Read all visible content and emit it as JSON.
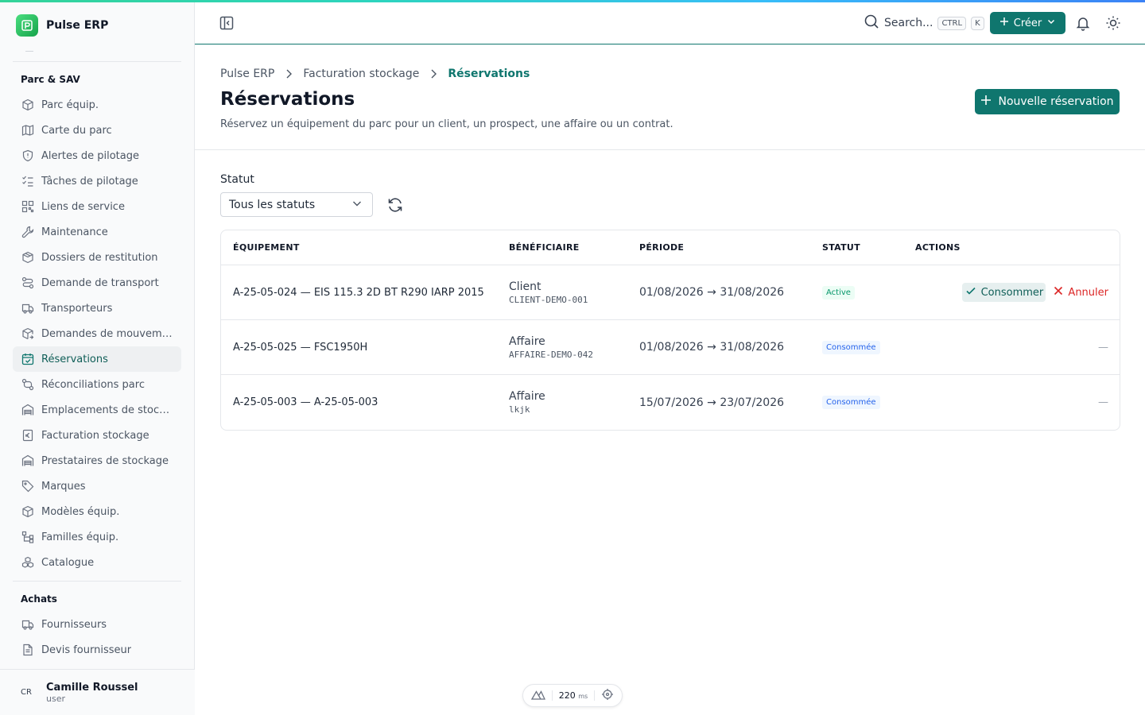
{
  "app": {
    "name": "Pulse ERP"
  },
  "colors": {
    "accent": "#0f766e",
    "active_badge": "#059669",
    "consumed_badge": "#2563eb",
    "danger": "#dc2626"
  },
  "sidebar": {
    "sections": [
      {
        "title": "Parc & SAV",
        "items": [
          {
            "label": "Parc équip.",
            "icon": "box-icon"
          },
          {
            "label": "Carte du parc",
            "icon": "map-icon"
          },
          {
            "label": "Alertes de pilotage",
            "icon": "shield-alert-icon"
          },
          {
            "label": "Tâches de pilotage",
            "icon": "checklist-icon"
          },
          {
            "label": "Liens de service",
            "icon": "qr-code-icon"
          },
          {
            "label": "Maintenance",
            "icon": "wrench-icon"
          },
          {
            "label": "Dossiers de restitution",
            "icon": "package-return-icon"
          },
          {
            "label": "Demande de transport",
            "icon": "route-icon"
          },
          {
            "label": "Transporteurs",
            "icon": "truck-icon"
          },
          {
            "label": "Demandes de mouvement",
            "icon": "package-move-icon"
          },
          {
            "label": "Réservations",
            "icon": "calendar-check-icon",
            "active": true
          },
          {
            "label": "Réconciliations parc",
            "icon": "git-compare-icon"
          },
          {
            "label": "Emplacements de stocka...",
            "icon": "warehouse-icon"
          },
          {
            "label": "Facturation stockage",
            "icon": "euro-icon"
          },
          {
            "label": "Prestataires de stockage",
            "icon": "warehouse-icon"
          },
          {
            "label": "Marques",
            "icon": "tag-icon"
          },
          {
            "label": "Modèles équip.",
            "icon": "cube-icon"
          },
          {
            "label": "Familles équip.",
            "icon": "tree-icon"
          },
          {
            "label": "Catalogue",
            "icon": "boxes-icon"
          }
        ]
      },
      {
        "title": "Achats",
        "items": [
          {
            "label": "Fournisseurs",
            "icon": "truck-icon"
          },
          {
            "label": "Devis fournisseur",
            "icon": "document-icon"
          }
        ]
      }
    ]
  },
  "user": {
    "initials": "CR",
    "name": "Camille Roussel",
    "role": "user"
  },
  "header": {
    "search_label": "Search...",
    "kbd_ctrl": "CTRL",
    "kbd_k": "K",
    "create_label": "Créer"
  },
  "breadcrumb": [
    "Pulse ERP",
    "Facturation stockage",
    "Réservations"
  ],
  "page": {
    "title": "Réservations",
    "subtitle": "Réservez un équipement du parc pour un client, un prospect, une affaire ou un contrat.",
    "new_button": "Nouvelle réservation"
  },
  "filter": {
    "label": "Statut",
    "value": "Tous les statuts"
  },
  "table": {
    "columns": [
      "ÉQUIPEMENT",
      "BÉNÉFICIAIRE",
      "PÉRIODE",
      "STATUT",
      "ACTIONS"
    ],
    "rows": [
      {
        "equipment": "A-25-05-024 — EIS 115.3 2D BT R290 IARP 2015",
        "beneficiary_type": "Client",
        "beneficiary_code": "CLIENT-DEMO-001",
        "period": "01/08/2026 → 31/08/2026",
        "status": "Active",
        "consume": "Consommer",
        "cancel": "Annuler"
      },
      {
        "equipment": "A-25-05-025 — FSC1950H",
        "beneficiary_type": "Affaire",
        "beneficiary_code": "AFFAIRE-DEMO-042",
        "period": "01/08/2026 → 31/08/2026",
        "status": "Consommée",
        "action_placeholder": "—"
      },
      {
        "equipment": "A-25-05-003 — A-25-05-003",
        "beneficiary_type": "Affaire",
        "beneficiary_code": "lkjk",
        "period": "15/07/2026 → 23/07/2026",
        "status": "Consommée",
        "action_placeholder": "—"
      }
    ]
  },
  "devtools": {
    "value": "220",
    "unit": "ms"
  }
}
